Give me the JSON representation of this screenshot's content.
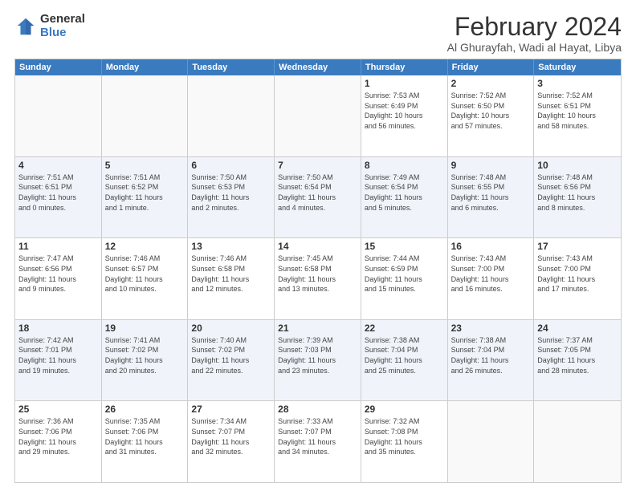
{
  "logo": {
    "general": "General",
    "blue": "Blue"
  },
  "title": "February 2024",
  "location": "Al Ghurayfah, Wadi al Hayat, Libya",
  "headers": [
    "Sunday",
    "Monday",
    "Tuesday",
    "Wednesday",
    "Thursday",
    "Friday",
    "Saturday"
  ],
  "rows": [
    [
      {
        "day": "",
        "info": ""
      },
      {
        "day": "",
        "info": ""
      },
      {
        "day": "",
        "info": ""
      },
      {
        "day": "",
        "info": ""
      },
      {
        "day": "1",
        "info": "Sunrise: 7:53 AM\nSunset: 6:49 PM\nDaylight: 10 hours\nand 56 minutes."
      },
      {
        "day": "2",
        "info": "Sunrise: 7:52 AM\nSunset: 6:50 PM\nDaylight: 10 hours\nand 57 minutes."
      },
      {
        "day": "3",
        "info": "Sunrise: 7:52 AM\nSunset: 6:51 PM\nDaylight: 10 hours\nand 58 minutes."
      }
    ],
    [
      {
        "day": "4",
        "info": "Sunrise: 7:51 AM\nSunset: 6:51 PM\nDaylight: 11 hours\nand 0 minutes."
      },
      {
        "day": "5",
        "info": "Sunrise: 7:51 AM\nSunset: 6:52 PM\nDaylight: 11 hours\nand 1 minute."
      },
      {
        "day": "6",
        "info": "Sunrise: 7:50 AM\nSunset: 6:53 PM\nDaylight: 11 hours\nand 2 minutes."
      },
      {
        "day": "7",
        "info": "Sunrise: 7:50 AM\nSunset: 6:54 PM\nDaylight: 11 hours\nand 4 minutes."
      },
      {
        "day": "8",
        "info": "Sunrise: 7:49 AM\nSunset: 6:54 PM\nDaylight: 11 hours\nand 5 minutes."
      },
      {
        "day": "9",
        "info": "Sunrise: 7:48 AM\nSunset: 6:55 PM\nDaylight: 11 hours\nand 6 minutes."
      },
      {
        "day": "10",
        "info": "Sunrise: 7:48 AM\nSunset: 6:56 PM\nDaylight: 11 hours\nand 8 minutes."
      }
    ],
    [
      {
        "day": "11",
        "info": "Sunrise: 7:47 AM\nSunset: 6:56 PM\nDaylight: 11 hours\nand 9 minutes."
      },
      {
        "day": "12",
        "info": "Sunrise: 7:46 AM\nSunset: 6:57 PM\nDaylight: 11 hours\nand 10 minutes."
      },
      {
        "day": "13",
        "info": "Sunrise: 7:46 AM\nSunset: 6:58 PM\nDaylight: 11 hours\nand 12 minutes."
      },
      {
        "day": "14",
        "info": "Sunrise: 7:45 AM\nSunset: 6:58 PM\nDaylight: 11 hours\nand 13 minutes."
      },
      {
        "day": "15",
        "info": "Sunrise: 7:44 AM\nSunset: 6:59 PM\nDaylight: 11 hours\nand 15 minutes."
      },
      {
        "day": "16",
        "info": "Sunrise: 7:43 AM\nSunset: 7:00 PM\nDaylight: 11 hours\nand 16 minutes."
      },
      {
        "day": "17",
        "info": "Sunrise: 7:43 AM\nSunset: 7:00 PM\nDaylight: 11 hours\nand 17 minutes."
      }
    ],
    [
      {
        "day": "18",
        "info": "Sunrise: 7:42 AM\nSunset: 7:01 PM\nDaylight: 11 hours\nand 19 minutes."
      },
      {
        "day": "19",
        "info": "Sunrise: 7:41 AM\nSunset: 7:02 PM\nDaylight: 11 hours\nand 20 minutes."
      },
      {
        "day": "20",
        "info": "Sunrise: 7:40 AM\nSunset: 7:02 PM\nDaylight: 11 hours\nand 22 minutes."
      },
      {
        "day": "21",
        "info": "Sunrise: 7:39 AM\nSunset: 7:03 PM\nDaylight: 11 hours\nand 23 minutes."
      },
      {
        "day": "22",
        "info": "Sunrise: 7:38 AM\nSunset: 7:04 PM\nDaylight: 11 hours\nand 25 minutes."
      },
      {
        "day": "23",
        "info": "Sunrise: 7:38 AM\nSunset: 7:04 PM\nDaylight: 11 hours\nand 26 minutes."
      },
      {
        "day": "24",
        "info": "Sunrise: 7:37 AM\nSunset: 7:05 PM\nDaylight: 11 hours\nand 28 minutes."
      }
    ],
    [
      {
        "day": "25",
        "info": "Sunrise: 7:36 AM\nSunset: 7:06 PM\nDaylight: 11 hours\nand 29 minutes."
      },
      {
        "day": "26",
        "info": "Sunrise: 7:35 AM\nSunset: 7:06 PM\nDaylight: 11 hours\nand 31 minutes."
      },
      {
        "day": "27",
        "info": "Sunrise: 7:34 AM\nSunset: 7:07 PM\nDaylight: 11 hours\nand 32 minutes."
      },
      {
        "day": "28",
        "info": "Sunrise: 7:33 AM\nSunset: 7:07 PM\nDaylight: 11 hours\nand 34 minutes."
      },
      {
        "day": "29",
        "info": "Sunrise: 7:32 AM\nSunset: 7:08 PM\nDaylight: 11 hours\nand 35 minutes."
      },
      {
        "day": "",
        "info": ""
      },
      {
        "day": "",
        "info": ""
      }
    ]
  ]
}
